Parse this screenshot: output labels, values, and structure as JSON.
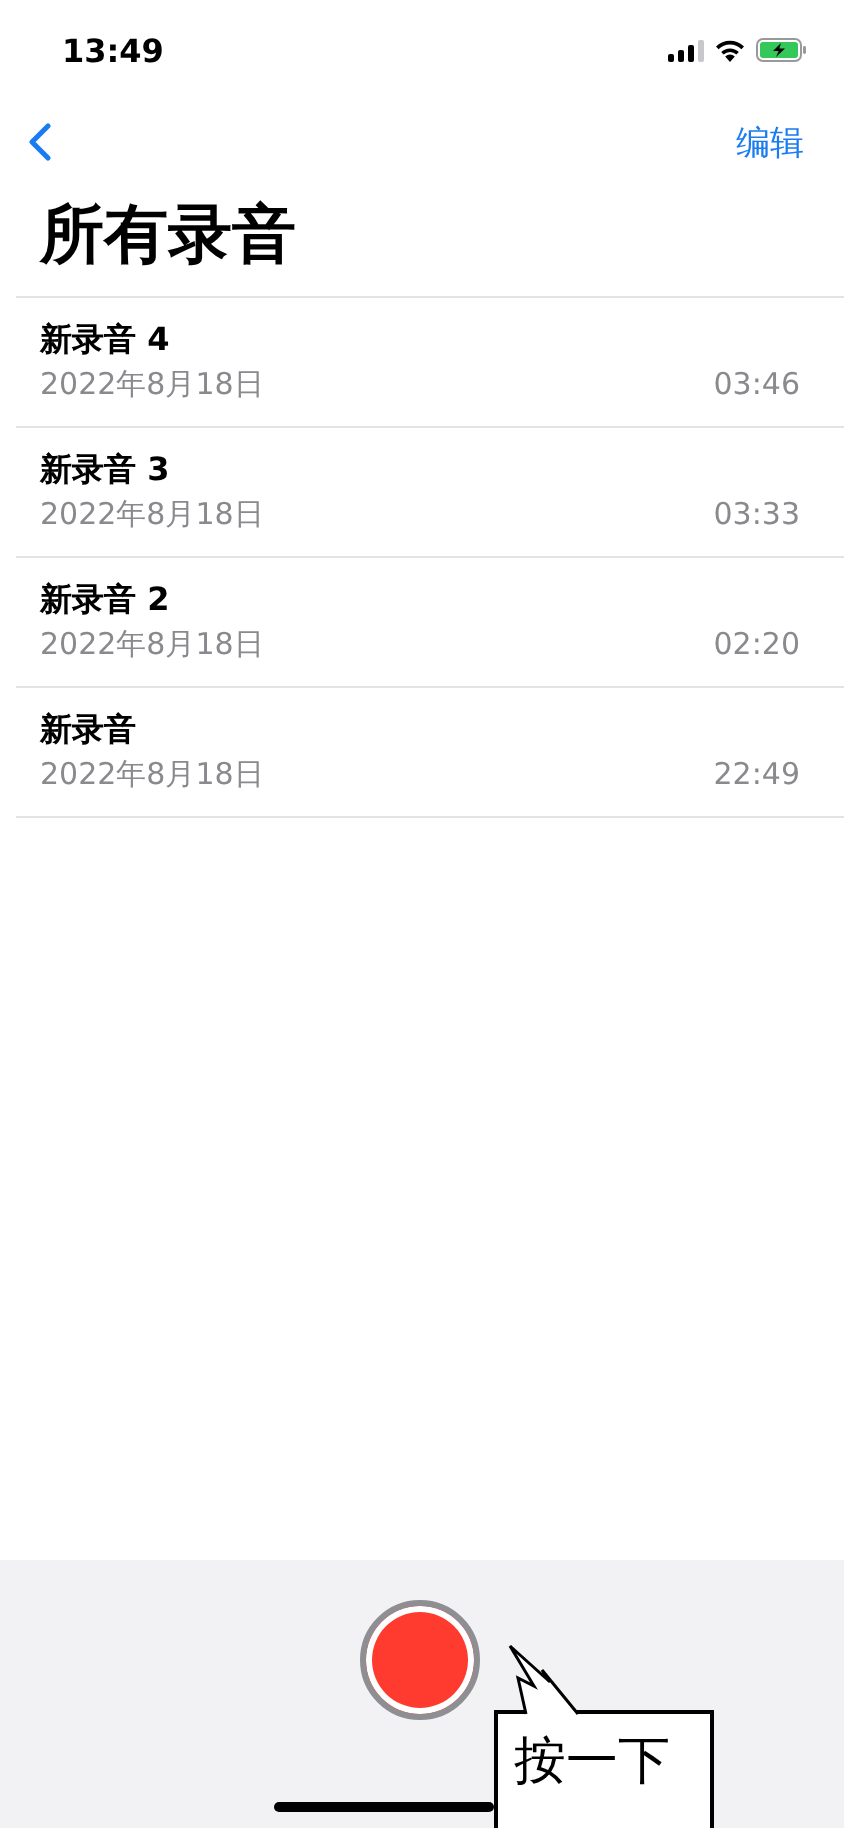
{
  "status_bar": {
    "time": "13:49",
    "battery_charging": true
  },
  "nav": {
    "edit": "编辑"
  },
  "title": "所有录音",
  "recordings": [
    {
      "name": "新录音 4",
      "date": "2022年8月18日",
      "duration": "03:46"
    },
    {
      "name": "新录音 3",
      "date": "2022年8月18日",
      "duration": "03:33"
    },
    {
      "name": "新录音 2",
      "date": "2022年8月18日",
      "duration": "02:20"
    },
    {
      "name": "新录音",
      "date": "2022年8月18日",
      "duration": "22:49"
    }
  ],
  "callout": {
    "text": "按一下"
  }
}
